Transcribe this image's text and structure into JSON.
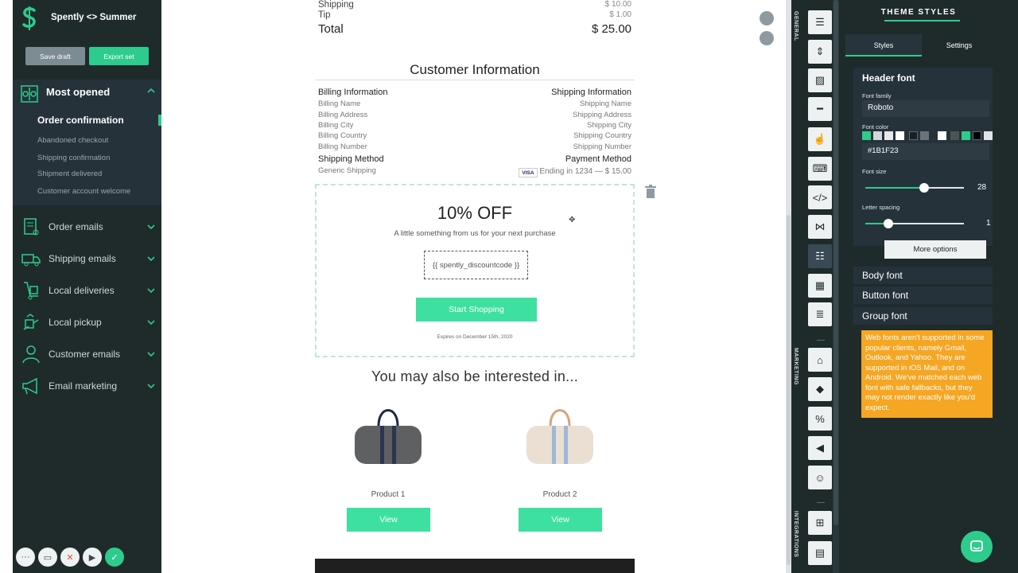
{
  "app": {
    "name": "Spently <> Summer"
  },
  "toolbar": {
    "save_label": "Save draft",
    "export_label": "Export set"
  },
  "sidebar": {
    "open_section": {
      "title": "Most opened",
      "items": [
        "Order confirmation",
        "Abandoned checkout",
        "Shipping confirmation",
        "Shipment delivered",
        "Customer account welcome"
      ],
      "active": "Order confirmation"
    },
    "sections": [
      {
        "label": "Order emails",
        "icon": "receipt-icon"
      },
      {
        "label": "Shipping emails",
        "icon": "truck-icon"
      },
      {
        "label": "Local deliveries",
        "icon": "dolly-icon"
      },
      {
        "label": "Local pickup",
        "icon": "pickup-icon"
      },
      {
        "label": "Customer emails",
        "icon": "user-icon"
      },
      {
        "label": "Email marketing",
        "icon": "megaphone-icon"
      }
    ]
  },
  "email": {
    "summary": {
      "shipping_label": "Shipping",
      "shipping_value": "$ 10.00",
      "tip_label": "Tip",
      "tip_value": "$ 1.00",
      "total_label": "Total",
      "total_value": "$ 25.00"
    },
    "customer_info": {
      "title": "Customer Information",
      "billing_title": "Billing Information",
      "billing_lines": [
        "Billing Name",
        "Billing Address",
        "Billing City",
        "Billing Country",
        "Billing Number"
      ],
      "shipping_title": "Shipping Information",
      "shipping_lines": [
        "Shipping Name",
        "Shipping Address",
        "Shipping City",
        "Shipping Country",
        "Shipping Number"
      ],
      "shipping_method_title": "Shipping Method",
      "shipping_method": "Generic Shipping",
      "payment_method_title": "Payment Method",
      "card_brand": "VISA",
      "payment_detail": "Ending in 1234 — $ 15.00"
    },
    "discount": {
      "headline": "10% OFF",
      "subtext": "A little something from us for your next purchase",
      "code": "{{ spently_discountcode }}",
      "cta": "Start Shopping",
      "expires": "Expires on December 15th, 2020"
    },
    "recommendations": {
      "title": "You may also be interested in...",
      "products": [
        {
          "name": "Product 1",
          "button": "View",
          "color": "#5e6062",
          "stripe": "#2b3550"
        },
        {
          "name": "Product 2",
          "button": "View",
          "color": "#eadfd2",
          "stripe": "#9fb7d8"
        }
      ]
    }
  },
  "tools": {
    "general_label": "GENERAL",
    "marketing_label": "MARKETING",
    "integrations_label": "INTEGRATIONS"
  },
  "panel": {
    "title": "THEME STYLES",
    "tabs": [
      "Styles",
      "Settings"
    ],
    "header_font": {
      "title": "Header font",
      "family_label": "Font family",
      "family_value": "Roboto",
      "color_label": "Font color",
      "color_value": "#1B1F23",
      "size_label": "Font size",
      "size_value": "28",
      "spacing_label": "Letter spacing",
      "spacing_value": "1",
      "more_label": "More options"
    },
    "other_fonts": [
      "Body font",
      "Button font",
      "Group font"
    ],
    "warning": "Web fonts aren't supported in some popular clients, namely Gmail, Outlook, and Yahoo. They are supported in iOS Mail, and on Android. We've matched each web font with safe fallbacks, but they may not render exactly like you'd expect.",
    "swatches": [
      "#2ecc8c",
      "#cfd7db",
      "#e8e8e8",
      "#ffffff",
      "#1b1f23",
      "#6b7378",
      "#ffffff",
      "#4a5358",
      "#2ecc8c",
      "#000000",
      "#dfe5e8"
    ],
    "accent": "#2ecc8c"
  }
}
